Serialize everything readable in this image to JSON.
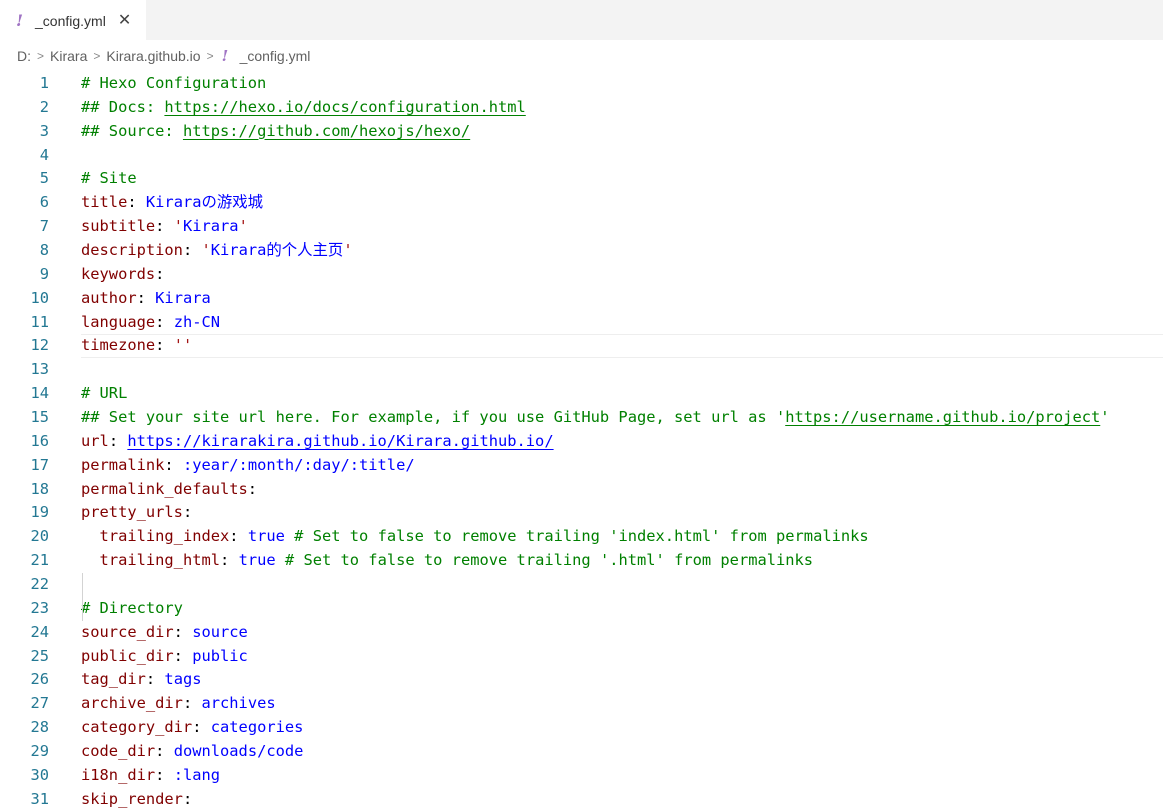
{
  "tab": {
    "icon": "yaml-exclamation-icon",
    "label": "_config.yml",
    "close": "✕"
  },
  "breadcrumb": {
    "drive": "D:",
    "folder1": "Kirara",
    "folder2": "Kirara.github.io",
    "file": "_config.yml",
    "sep": ">"
  },
  "lines": [
    {
      "n": "1",
      "parts": [
        [
          "c",
          "# Hexo Configuration"
        ]
      ]
    },
    {
      "n": "2",
      "parts": [
        [
          "c",
          "## Docs: "
        ],
        [
          "lk",
          "https://hexo.io/docs/configuration.html"
        ]
      ]
    },
    {
      "n": "3",
      "parts": [
        [
          "c",
          "## Source: "
        ],
        [
          "lk",
          "https://github.com/hexojs/hexo/"
        ]
      ]
    },
    {
      "n": "4",
      "parts": []
    },
    {
      "n": "5",
      "parts": [
        [
          "c",
          "# Site"
        ]
      ]
    },
    {
      "n": "6",
      "parts": [
        [
          "k",
          "title"
        ],
        [
          "p",
          ": "
        ],
        [
          "u",
          "Kiraraの游戏城"
        ]
      ]
    },
    {
      "n": "7",
      "parts": [
        [
          "k",
          "subtitle"
        ],
        [
          "p",
          ": "
        ],
        [
          "s",
          "'"
        ],
        [
          "u",
          "Kirara"
        ],
        [
          "s",
          "'"
        ]
      ]
    },
    {
      "n": "8",
      "parts": [
        [
          "k",
          "description"
        ],
        [
          "p",
          ": "
        ],
        [
          "s",
          "'"
        ],
        [
          "u",
          "Kirara的个人主页"
        ],
        [
          "s",
          "'"
        ]
      ]
    },
    {
      "n": "9",
      "parts": [
        [
          "k",
          "keywords"
        ],
        [
          "p",
          ":"
        ]
      ]
    },
    {
      "n": "10",
      "parts": [
        [
          "k",
          "author"
        ],
        [
          "p",
          ": "
        ],
        [
          "u",
          "Kirara"
        ]
      ]
    },
    {
      "n": "11",
      "parts": [
        [
          "k",
          "language"
        ],
        [
          "p",
          ": "
        ],
        [
          "u",
          "zh-CN"
        ]
      ]
    },
    {
      "n": "12",
      "current": true,
      "parts": [
        [
          "k",
          "timezone"
        ],
        [
          "p",
          ": "
        ],
        [
          "s",
          "''"
        ]
      ]
    },
    {
      "n": "13",
      "parts": []
    },
    {
      "n": "14",
      "parts": [
        [
          "c",
          "# URL"
        ]
      ]
    },
    {
      "n": "15",
      "parts": [
        [
          "c",
          "## Set your site url here. For example, if you use GitHub Page, set url as '"
        ],
        [
          "lk",
          "https://username.github.io/project"
        ],
        [
          "c",
          "'"
        ]
      ]
    },
    {
      "n": "16",
      "parts": [
        [
          "k",
          "url"
        ],
        [
          "p",
          ": "
        ],
        [
          "lb",
          "https://kirarakira.github.io/Kirara.github.io/"
        ]
      ]
    },
    {
      "n": "17",
      "parts": [
        [
          "k",
          "permalink"
        ],
        [
          "p",
          ": "
        ],
        [
          "u",
          ":year/:month/:day/:title/"
        ]
      ]
    },
    {
      "n": "18",
      "parts": [
        [
          "k",
          "permalink_defaults"
        ],
        [
          "p",
          ":"
        ]
      ]
    },
    {
      "n": "19",
      "parts": [
        [
          "k",
          "pretty_urls"
        ],
        [
          "p",
          ":"
        ]
      ]
    },
    {
      "n": "20",
      "parts": [
        [
          "p",
          "  "
        ],
        [
          "k",
          "trailing_index"
        ],
        [
          "p",
          ": "
        ],
        [
          "l",
          "true"
        ],
        [
          "c",
          " # Set to false to remove trailing 'index.html' from permalinks"
        ]
      ]
    },
    {
      "n": "21",
      "parts": [
        [
          "p",
          "  "
        ],
        [
          "k",
          "trailing_html"
        ],
        [
          "p",
          ": "
        ],
        [
          "l",
          "true"
        ],
        [
          "c",
          " # Set to false to remove trailing '.html' from permalinks"
        ]
      ]
    },
    {
      "n": "22",
      "parts": []
    },
    {
      "n": "23",
      "parts": [
        [
          "c",
          "# Directory"
        ]
      ]
    },
    {
      "n": "24",
      "parts": [
        [
          "k",
          "source_dir"
        ],
        [
          "p",
          ": "
        ],
        [
          "u",
          "source"
        ]
      ]
    },
    {
      "n": "25",
      "parts": [
        [
          "k",
          "public_dir"
        ],
        [
          "p",
          ": "
        ],
        [
          "u",
          "public"
        ]
      ]
    },
    {
      "n": "26",
      "parts": [
        [
          "k",
          "tag_dir"
        ],
        [
          "p",
          ": "
        ],
        [
          "u",
          "tags"
        ]
      ]
    },
    {
      "n": "27",
      "parts": [
        [
          "k",
          "archive_dir"
        ],
        [
          "p",
          ": "
        ],
        [
          "u",
          "archives"
        ]
      ]
    },
    {
      "n": "28",
      "parts": [
        [
          "k",
          "category_dir"
        ],
        [
          "p",
          ": "
        ],
        [
          "u",
          "categories"
        ]
      ]
    },
    {
      "n": "29",
      "parts": [
        [
          "k",
          "code_dir"
        ],
        [
          "p",
          ": "
        ],
        [
          "u",
          "downloads/code"
        ]
      ]
    },
    {
      "n": "30",
      "parts": [
        [
          "k",
          "i18n_dir"
        ],
        [
          "p",
          ": "
        ],
        [
          "u",
          ":lang"
        ]
      ]
    },
    {
      "n": "31",
      "parts": [
        [
          "k",
          "skip_render"
        ],
        [
          "p",
          ":"
        ]
      ]
    }
  ]
}
